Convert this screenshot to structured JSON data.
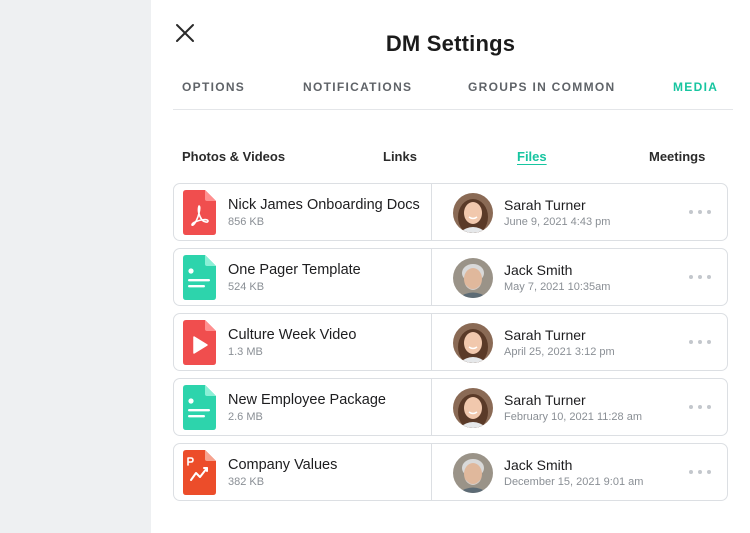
{
  "header": {
    "title": "DM Settings"
  },
  "tabs": [
    {
      "label": "OPTIONS",
      "active": false
    },
    {
      "label": "NOTIFICATIONS",
      "active": false
    },
    {
      "label": "GROUPS IN COMMON",
      "active": false
    },
    {
      "label": "MEDIA",
      "active": true
    }
  ],
  "subtabs": [
    {
      "label": "Photos & Videos",
      "active": false
    },
    {
      "label": "Links",
      "active": false
    },
    {
      "label": "Files",
      "active": true
    },
    {
      "label": "Meetings",
      "active": false
    }
  ],
  "files": [
    {
      "name": "Nick James Onboarding Docs",
      "size": "856 KB",
      "type": "pdf",
      "user": "Sarah Turner",
      "date": "June 9, 2021 4:43 pm"
    },
    {
      "name": "One Pager Template",
      "size": "524 KB",
      "type": "doc",
      "user": "Jack Smith",
      "date": "May 7, 2021 10:35am"
    },
    {
      "name": "Culture Week Video",
      "size": "1.3 MB",
      "type": "video",
      "user": "Sarah Turner",
      "date": "April 25, 2021 3:12 pm"
    },
    {
      "name": "New Employee Package",
      "size": "2.6 MB",
      "type": "doc",
      "user": "Sarah Turner",
      "date": "February 10, 2021 11:28 am"
    },
    {
      "name": "Company Values",
      "size": "382 KB",
      "type": "ppt",
      "user": "Jack Smith",
      "date": "December 15, 2021 9:01 am"
    }
  ],
  "icons": {
    "close": "close-icon",
    "more": "more-horizontal-icon",
    "pdf": "pdf-file-icon",
    "doc": "document-file-icon",
    "video": "video-file-icon",
    "ppt": "presentation-file-icon"
  },
  "colors": {
    "accent": "#17c5a0",
    "pdf": "#f04e4e",
    "doc": "#2dd4ac",
    "video": "#f04e4e",
    "ppt": "#ec4d2a"
  }
}
